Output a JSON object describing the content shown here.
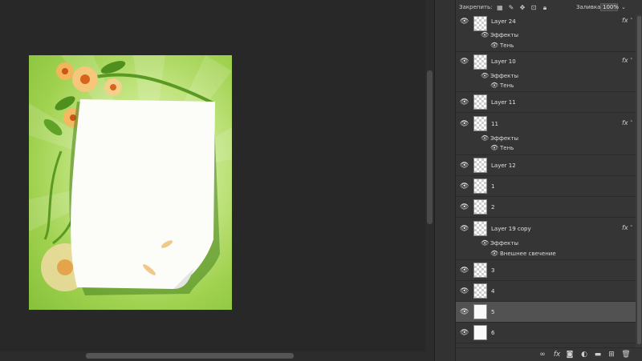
{
  "lock_bar": {
    "label": "Закрепить:",
    "icons": [
      "lock-transparent-icon",
      "brush-icon",
      "move-icon",
      "artboard-icon",
      "lock-icon"
    ],
    "fill_label": "Заливка:",
    "fill_value": "100%"
  },
  "layers": [
    {
      "name": "Layer 24",
      "fx": "fx",
      "effects_label": "Эффекты",
      "effect": "Тень"
    },
    {
      "name": "Layer 10",
      "fx": "fx",
      "effects_label": "Эффекты",
      "effect": "Тень"
    },
    {
      "name": "Layer 11"
    },
    {
      "name": "11",
      "fx": "fx",
      "effects_label": "Эффекты",
      "effect": "Тень"
    },
    {
      "name": "Layer 12"
    },
    {
      "name": "1"
    },
    {
      "name": "2"
    },
    {
      "name": "Layer 19 copy",
      "fx": "fx",
      "effects_label": "Эффекты",
      "effect": "Внешнее свечение"
    },
    {
      "name": "3"
    },
    {
      "name": "4"
    },
    {
      "name": "5",
      "selected": true
    },
    {
      "name": "6"
    }
  ],
  "bottom_icons": [
    "link-icon",
    "fx-icon",
    "mask-icon",
    "adjustment-icon",
    "folder-icon",
    "new-layer-icon",
    "trash-icon"
  ],
  "bottom_fx_label": "fx",
  "colors": {
    "panel": "#353535",
    "selected": "#525252",
    "workspace": "#282828"
  }
}
